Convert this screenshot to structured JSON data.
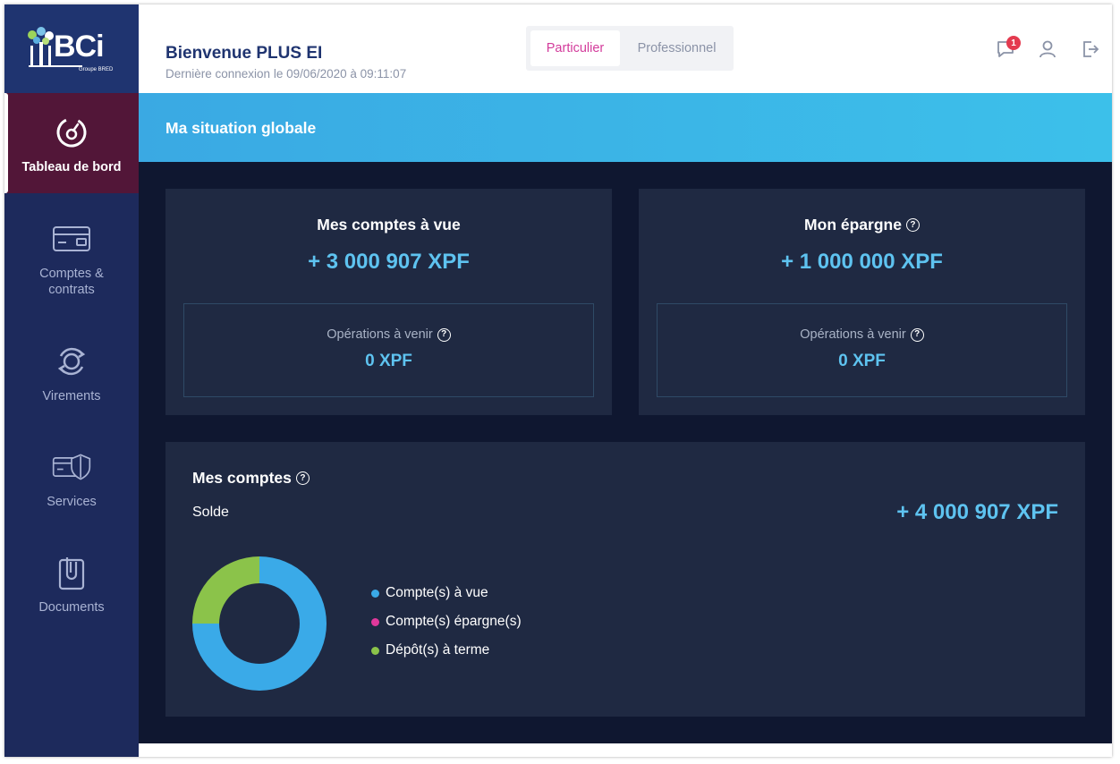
{
  "brand": {
    "logo_text": "BCi",
    "logo_subtitle": "Groupe BRED"
  },
  "sidebar": {
    "items": [
      {
        "label": "Tableau de bord",
        "icon": "dashboard-icon",
        "active": true
      },
      {
        "label": "Comptes & contrats",
        "icon": "card-icon",
        "active": false
      },
      {
        "label": "Virements",
        "icon": "transfer-icon",
        "active": false
      },
      {
        "label": "Services",
        "icon": "shield-card-icon",
        "active": false
      },
      {
        "label": "Documents",
        "icon": "clipboard-icon",
        "active": false
      }
    ]
  },
  "header": {
    "welcome": "Bienvenue PLUS EI",
    "last_login": "Dernière connexion le 09/06/2020 à 09:11:07",
    "segments": [
      "Particulier",
      "Professionnel"
    ],
    "active_segment": "Particulier",
    "notification_count": "1",
    "icons": [
      "message-icon",
      "user-icon",
      "logout-icon"
    ]
  },
  "banner": {
    "title": "Ma situation globale"
  },
  "cards": {
    "comptes_vue": {
      "title": "Mes comptes à vue",
      "amount": "+ 3 000 907 XPF",
      "upcoming_label": "Opérations à venir",
      "upcoming_value": "0 XPF"
    },
    "epargne": {
      "title": "Mon épargne",
      "amount": "+ 1 000 000 XPF",
      "upcoming_label": "Opérations à venir",
      "upcoming_value": "0 XPF"
    },
    "mes_comptes": {
      "title": "Mes comptes",
      "solde_label": "Solde",
      "solde_value": "+ 4 000 907 XPF"
    }
  },
  "chart_data": {
    "type": "pie",
    "donut": true,
    "categories": [
      "Compte(s) à vue",
      "Compte(s) épargne(s)",
      "Dépôt(s) à terme"
    ],
    "values": [
      3000907,
      0,
      1000000
    ],
    "colors": [
      "#3aaae8",
      "#e0389b",
      "#8bc34a"
    ]
  },
  "colors": {
    "accent": "#5ec3f0",
    "active_nav": "#521638",
    "sidebar": "#1d2a5c",
    "segment_active": "#d33b9b",
    "banner": "#3cc0ea"
  }
}
